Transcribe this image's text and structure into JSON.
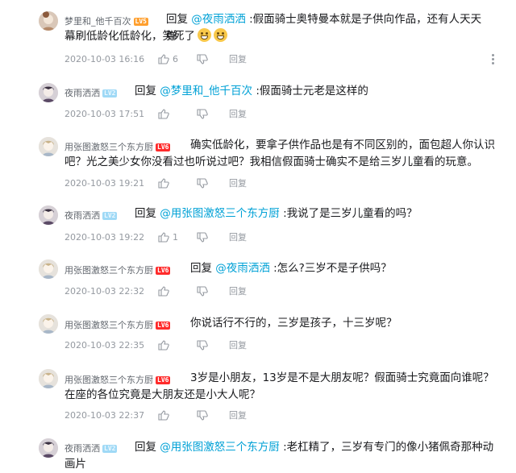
{
  "replies": [
    {
      "user": "梦里和_他千百次",
      "level": "LV5",
      "prefix": "回复 ",
      "at": "@夜雨洒洒",
      "text": " :假面骑士奥特曼本就是子供向作品，还有人天天弹",
      "text2": "幕刷低龄化低龄化，笑死了",
      "emojis": [
        "grin-emoji",
        "laugh-emoji"
      ],
      "time": "2020-10-03 16:16",
      "likes": "6",
      "reply_label": "回复"
    },
    {
      "user": "夜雨洒洒",
      "level": "LV2",
      "prefix": "回复 ",
      "at": "@梦里和_他千百次",
      "text": " :假面骑士元老是这样的",
      "time": "2020-10-03 17:51",
      "likes": "",
      "reply_label": "回复"
    },
    {
      "user": "用张图激怒三个东方厨",
      "level": "LV6",
      "text": "确实低龄化，要拿子供作品也是有不同区别的，面包超人你认识",
      "text2": "吧？光之美少女你没看过也听说过吧？我相信假面骑士确实不是给三岁儿童看的玩意。",
      "time": "2020-10-03 19:21",
      "likes": "",
      "reply_label": "回复"
    },
    {
      "user": "夜雨洒洒",
      "level": "LV2",
      "prefix": "回复 ",
      "at": "@用张图激怒三个东方厨",
      "text": " :我说了是三岁儿童看的吗？",
      "time": "2020-10-03 19:22",
      "likes": "1",
      "reply_label": "回复"
    },
    {
      "user": "用张图激怒三个东方厨",
      "level": "LV6",
      "prefix": "回复 ",
      "at": "@夜雨洒洒",
      "text": " :怎么?三岁不是子供吗？",
      "time": "2020-10-03 22:32",
      "likes": "",
      "reply_label": "回复"
    },
    {
      "user": "用张图激怒三个东方厨",
      "level": "LV6",
      "text": "你说话行不行的，三岁是孩子，十三岁呢？",
      "time": "2020-10-03 22:35",
      "likes": "",
      "reply_label": "回复"
    },
    {
      "user": "用张图激怒三个东方厨",
      "level": "LV6",
      "text": "3岁是小朋友，13岁是不是大朋友呢？假面骑士究竟面向谁呢？",
      "text2": "在座的各位究竟是大朋友还是小大人呢？",
      "time": "2020-10-03 22:37",
      "likes": "",
      "reply_label": "回复"
    },
    {
      "user": "夜雨洒洒",
      "level": "LV2",
      "prefix": "回复 ",
      "at": "@用张图激怒三个东方厨",
      "text": " :老杠精了，三岁有专门的像小猪佩奇那种动",
      "text2": "画片"
    }
  ],
  "colors": {
    "link": "#00a1d6",
    "meta": "#9499a0",
    "lv5": "#ff9f2e",
    "lv6": "#ff2b2b",
    "lv2": "#9fd9f6"
  }
}
